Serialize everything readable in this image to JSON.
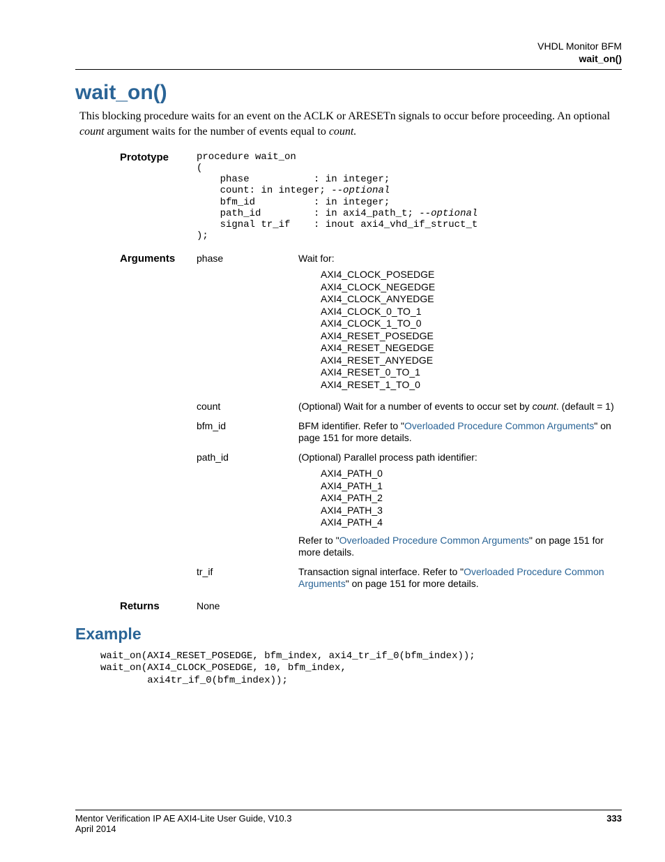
{
  "header": {
    "line1": "VHDL Monitor BFM",
    "line2": "wait_on()"
  },
  "title": "wait_on()",
  "intro": {
    "pre": "This blocking procedure waits for an event on the ACLK or ARESETn signals to occur before proceeding. An optional ",
    "em1": "count",
    "mid": " argument waits for the number of events equal to ",
    "em2": "count.",
    "post": ""
  },
  "labels": {
    "prototype": "Prototype",
    "arguments": "Arguments",
    "returns": "Returns"
  },
  "prototype": "procedure wait_on\n(\n    phase           : in integer;\n    count: in integer; --optional\n    bfm_id          : in integer;\n    path_id         : in axi4_path_t; --optional\n    signal tr_if    : inout axi4_vhd_if_struct_t\n);",
  "proto_italic": "--optional",
  "args": {
    "phase": {
      "name": "phase",
      "desc": "Wait for:",
      "list": "AXI4_CLOCK_POSEDGE\nAXI4_CLOCK_NEGEDGE\nAXI4_CLOCK_ANYEDGE\nAXI4_CLOCK_0_TO_1\nAXI4_CLOCK_1_TO_0\nAXI4_RESET_POSEDGE\nAXI4_RESET_NEGEDGE\nAXI4_RESET_ANYEDGE\nAXI4_RESET_0_TO_1\nAXI4_RESET_1_TO_0"
    },
    "count": {
      "name": "count",
      "desc_pre": "(Optional) Wait for a number of events to occur set by ",
      "em": "count",
      "desc_post": ". (default = 1)"
    },
    "bfm_id": {
      "name": "bfm_id",
      "desc_pre": "BFM identifier. Refer to \"",
      "link": "Overloaded Procedure Common Arguments",
      "desc_post": "\" on page 151 for more details."
    },
    "path_id": {
      "name": "path_id",
      "desc": "(Optional) Parallel process path identifier:",
      "list": "AXI4_PATH_0\nAXI4_PATH_1\nAXI4_PATH_2\nAXI4_PATH_3\nAXI4_PATH_4",
      "refer_pre": "Refer to \"",
      "link": "Overloaded Procedure Common Arguments",
      "refer_post": "\" on page 151 for more details."
    },
    "tr_if": {
      "name": "tr_if",
      "desc_pre": "Transaction signal interface. Refer to \"",
      "link": "Overloaded Procedure Common Arguments",
      "desc_post": "\" on page 151 for more details."
    }
  },
  "returns_val": "None",
  "example_h": "Example",
  "example_code": "wait_on(AXI4_RESET_POSEDGE, bfm_index, axi4_tr_if_0(bfm_index));\nwait_on(AXI4_CLOCK_POSEDGE, 10, bfm_index,\n        axi4tr_if_0(bfm_index));",
  "footer": {
    "left1": "Mentor Verification IP AE AXI4-Lite User Guide, V10.3",
    "left2": "April 2014",
    "page": "333"
  }
}
